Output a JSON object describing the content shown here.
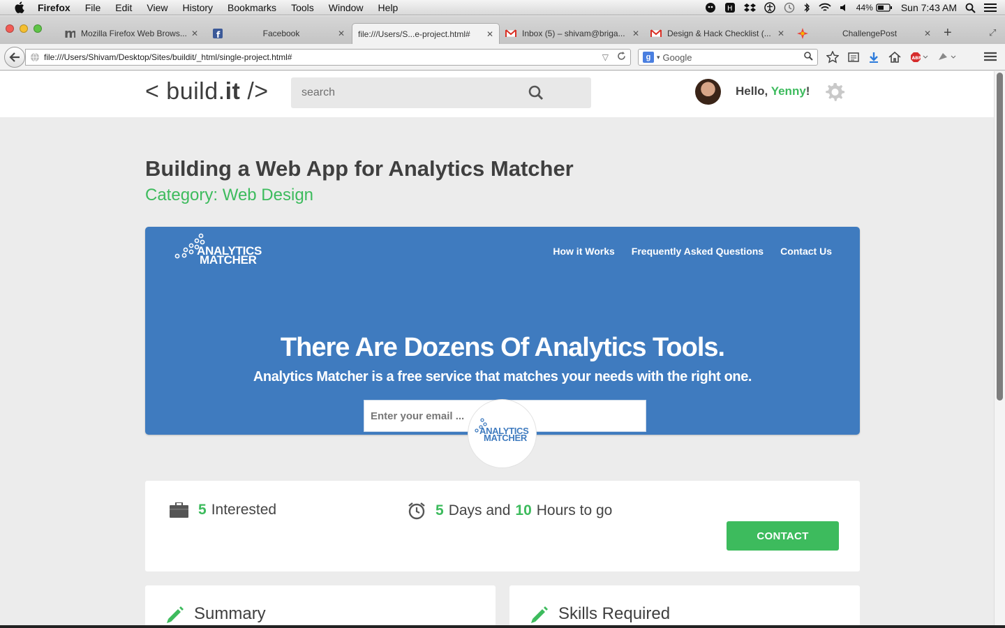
{
  "os_menubar": {
    "app_name": "Firefox",
    "menus": [
      "File",
      "Edit",
      "View",
      "History",
      "Bookmarks",
      "Tools",
      "Window",
      "Help"
    ],
    "battery": "44%",
    "clock": "Sun 7:43 AM"
  },
  "browser": {
    "tabs": [
      {
        "title": "Mozilla Firefox Web Brows...",
        "icon": "mozilla-icon"
      },
      {
        "title": "Facebook",
        "icon": "facebook-icon"
      },
      {
        "title": "file:///Users/S...e-project.html#",
        "icon": "none",
        "active": true
      },
      {
        "title": "Inbox (5) – shivam@briga...",
        "icon": "gmail-icon"
      },
      {
        "title": "Design & Hack Checklist (...",
        "icon": "gmail-icon"
      },
      {
        "title": "ChallengePost",
        "icon": "challengepost-icon"
      }
    ],
    "url": "file:///Users/Shivam/Desktop/Sites/buildit/_html/single-project.html#",
    "search_engine_placeholder": "Google"
  },
  "site": {
    "logo_prefix": "< build.",
    "logo_strong": "it",
    "logo_suffix": " />",
    "search_placeholder": "search",
    "greeting_prefix": "Hello, ",
    "user_name": "Yenny",
    "greeting_suffix": "!"
  },
  "project": {
    "title": "Building a Web App for Analytics Matcher",
    "category": "Category: Web Design",
    "preview": {
      "logo_line1": "ANALYTICS",
      "logo_line2": "MATCHER",
      "nav": [
        "How it Works",
        "Frequently Asked Questions",
        "Contact Us"
      ],
      "headline": "There Are Dozens Of Analytics Tools.",
      "subheadline": "Analytics Matcher is a free service that matches your needs with the right one.",
      "email_placeholder": "Enter your email ..."
    },
    "badge_line1": "ANALYTICS",
    "badge_line2": "MATCHER",
    "stats": {
      "interested_count": "5",
      "interested_label": "Interested",
      "days": "5",
      "days_label": "Days and",
      "hours": "10",
      "hours_label": "Hours to go"
    },
    "contact_label": "CONTACT",
    "cards": [
      {
        "title": "Summary"
      },
      {
        "title": "Skills Required"
      }
    ]
  },
  "colors": {
    "accent_green": "#3dbb5d",
    "preview_blue": "#3f7bbf",
    "page_bg": "#ececec"
  }
}
